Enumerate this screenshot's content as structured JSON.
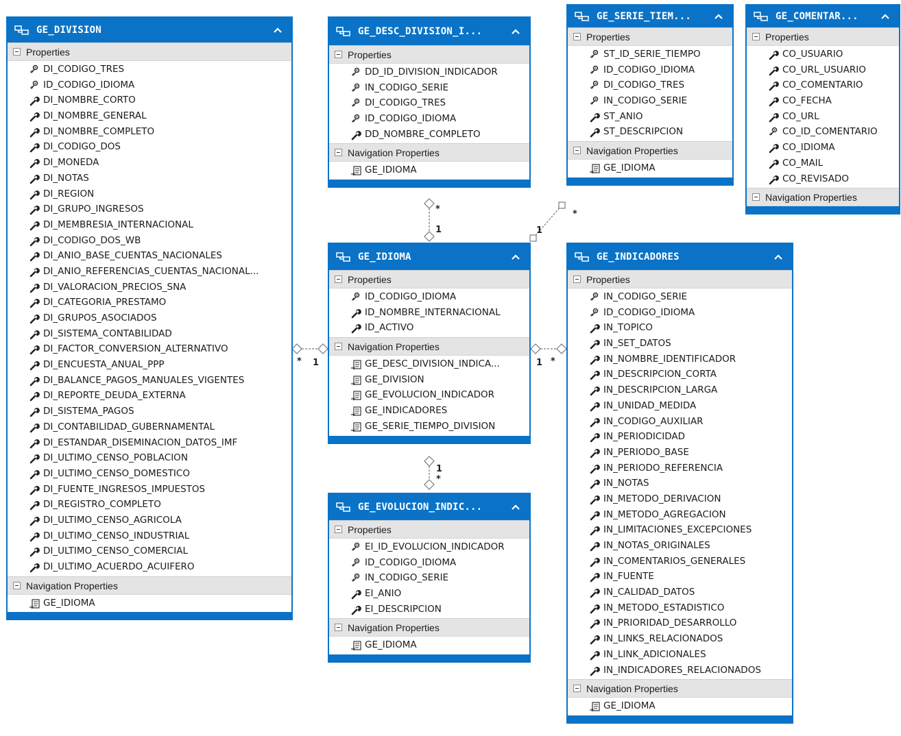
{
  "entities": {
    "division": {
      "title": "GE_DIVISION",
      "properties_label": "Properties",
      "nav_label": "Navigation Properties",
      "properties": [
        {
          "name": "DI_CODIGO_TRES",
          "icon": "key-icon"
        },
        {
          "name": "ID_CODIGO_IDIOMA",
          "icon": "key-icon"
        },
        {
          "name": "DI_NOMBRE_CORTO",
          "icon": "property-wrench-icon"
        },
        {
          "name": "DI_NOMBRE_GENERAL",
          "icon": "property-wrench-icon"
        },
        {
          "name": "DI_NOMBRE_COMPLETO",
          "icon": "property-wrench-icon"
        },
        {
          "name": "DI_CODIGO_DOS",
          "icon": "property-wrench-icon"
        },
        {
          "name": "DI_MONEDA",
          "icon": "property-wrench-icon"
        },
        {
          "name": "DI_NOTAS",
          "icon": "property-wrench-icon"
        },
        {
          "name": "DI_REGION",
          "icon": "property-wrench-icon"
        },
        {
          "name": "DI_GRUPO_INGRESOS",
          "icon": "property-wrench-icon"
        },
        {
          "name": "DI_MEMBRESIA_INTERNACIONAL",
          "icon": "property-wrench-icon"
        },
        {
          "name": "DI_CODIGO_DOS_WB",
          "icon": "property-wrench-icon"
        },
        {
          "name": "DI_ANIO_BASE_CUENTAS_NACIONALES",
          "icon": "property-wrench-icon"
        },
        {
          "name": "DI_ANIO_REFERENCIAS_CUENTAS_NACIONAL...",
          "icon": "property-wrench-icon"
        },
        {
          "name": "DI_VALORACION_PRECIOS_SNA",
          "icon": "property-wrench-icon"
        },
        {
          "name": "DI_CATEGORIA_PRESTAMO",
          "icon": "property-wrench-icon"
        },
        {
          "name": "DI_GRUPOS_ASOCIADOS",
          "icon": "property-wrench-icon"
        },
        {
          "name": "DI_SISTEMA_CONTABILIDAD",
          "icon": "property-wrench-icon"
        },
        {
          "name": "DI_FACTOR_CONVERSION_ALTERNATIVO",
          "icon": "property-wrench-icon"
        },
        {
          "name": "DI_ENCUESTA_ANUAL_PPP",
          "icon": "property-wrench-icon"
        },
        {
          "name": "DI_BALANCE_PAGOS_MANUALES_VIGENTES",
          "icon": "property-wrench-icon"
        },
        {
          "name": "DI_REPORTE_DEUDA_EXTERNA",
          "icon": "property-wrench-icon"
        },
        {
          "name": "DI_SISTEMA_PAGOS",
          "icon": "property-wrench-icon"
        },
        {
          "name": "DI_CONTABILIDAD_GUBERNAMENTAL",
          "icon": "property-wrench-icon"
        },
        {
          "name": "DI_ESTANDAR_DISEMINACION_DATOS_IMF",
          "icon": "property-wrench-icon"
        },
        {
          "name": "DI_ULTIMO_CENSO_POBLACION",
          "icon": "property-wrench-icon"
        },
        {
          "name": "DI_ULTIMO_CENSO_DOMESTICO",
          "icon": "property-wrench-icon"
        },
        {
          "name": "DI_FUENTE_INGRESOS_IMPUESTOS",
          "icon": "property-wrench-icon"
        },
        {
          "name": "DI_REGISTRO_COMPLETO",
          "icon": "property-wrench-icon"
        },
        {
          "name": "DI_ULTIMO_CENSO_AGRICOLA",
          "icon": "property-wrench-icon"
        },
        {
          "name": "DI_ULTIMO_CENSO_INDUSTRIAL",
          "icon": "property-wrench-icon"
        },
        {
          "name": "DI_ULTIMO_CENSO_COMERCIAL",
          "icon": "property-wrench-icon"
        },
        {
          "name": "DI_ULTIMO_ACUERDO_ACUIFERO",
          "icon": "property-wrench-icon"
        }
      ],
      "navigation": [
        {
          "name": "GE_IDIOMA",
          "icon": "navigation-property-icon"
        }
      ]
    },
    "desc_division": {
      "title": "GE_DESC_DIVISION_I...",
      "properties_label": "Properties",
      "nav_label": "Navigation Properties",
      "properties": [
        {
          "name": "DD_ID_DIVISION_INDICADOR",
          "icon": "key-icon"
        },
        {
          "name": "IN_CODIGO_SERIE",
          "icon": "key-icon"
        },
        {
          "name": "DI_CODIGO_TRES",
          "icon": "key-icon"
        },
        {
          "name": "ID_CODIGO_IDIOMA",
          "icon": "key-icon"
        },
        {
          "name": "DD_NOMBRE_COMPLETO",
          "icon": "property-wrench-icon"
        }
      ],
      "navigation": [
        {
          "name": "GE_IDIOMA",
          "icon": "navigation-property-icon"
        }
      ]
    },
    "serie_tiempo": {
      "title": "GE_SERIE_TIEM...",
      "properties_label": "Properties",
      "nav_label": "Navigation Properties",
      "properties": [
        {
          "name": "ST_ID_SERIE_TIEMPO",
          "icon": "key-icon"
        },
        {
          "name": "ID_CODIGO_IDIOMA",
          "icon": "key-icon"
        },
        {
          "name": "DI_CODIGO_TRES",
          "icon": "key-icon"
        },
        {
          "name": "IN_CODIGO_SERIE",
          "icon": "key-icon"
        },
        {
          "name": "ST_ANIO",
          "icon": "property-wrench-icon"
        },
        {
          "name": "ST_DESCRIPCION",
          "icon": "property-wrench-icon"
        }
      ],
      "navigation": [
        {
          "name": "GE_IDIOMA",
          "icon": "navigation-property-icon"
        }
      ]
    },
    "comentario": {
      "title": "GE_COMENTAR...",
      "properties_label": "Properties",
      "nav_label": "Navigation Properties",
      "properties": [
        {
          "name": "CO_USUARIO",
          "icon": "property-wrench-icon"
        },
        {
          "name": "CO_URL_USUARIO",
          "icon": "property-wrench-icon"
        },
        {
          "name": "CO_COMENTARIO",
          "icon": "property-wrench-icon"
        },
        {
          "name": "CO_FECHA",
          "icon": "property-wrench-icon"
        },
        {
          "name": "CO_URL",
          "icon": "property-wrench-icon"
        },
        {
          "name": "CO_ID_COMENTARIO",
          "icon": "key-icon"
        },
        {
          "name": "CO_IDIOMA",
          "icon": "property-wrench-icon"
        },
        {
          "name": "CO_MAIL",
          "icon": "property-wrench-icon"
        },
        {
          "name": "CO_REVISADO",
          "icon": "property-wrench-icon"
        }
      ],
      "navigation": []
    },
    "idioma": {
      "title": "GE_IDIOMA",
      "properties_label": "Properties",
      "nav_label": "Navigation Properties",
      "properties": [
        {
          "name": "ID_CODIGO_IDIOMA",
          "icon": "key-icon"
        },
        {
          "name": "ID_NOMBRE_INTERNACIONAL",
          "icon": "property-wrench-icon"
        },
        {
          "name": "ID_ACTIVO",
          "icon": "property-wrench-icon"
        }
      ],
      "navigation": [
        {
          "name": "GE_DESC_DIVISION_INDICA...",
          "icon": "navigation-property-icon"
        },
        {
          "name": "GE_DIVISION",
          "icon": "navigation-property-icon"
        },
        {
          "name": "GE_EVOLUCION_INDICADOR",
          "icon": "navigation-property-icon"
        },
        {
          "name": "GE_INDICADORES",
          "icon": "navigation-property-icon"
        },
        {
          "name": "GE_SERIE_TIEMPO_DIVISION",
          "icon": "navigation-property-icon"
        }
      ]
    },
    "evolucion": {
      "title": "GE_EVOLUCION_INDIC...",
      "properties_label": "Properties",
      "nav_label": "Navigation Properties",
      "properties": [
        {
          "name": "EI_ID_EVOLUCION_INDICADOR",
          "icon": "key-icon"
        },
        {
          "name": "ID_CODIGO_IDIOMA",
          "icon": "key-icon"
        },
        {
          "name": "IN_CODIGO_SERIE",
          "icon": "key-icon"
        },
        {
          "name": "EI_ANIO",
          "icon": "property-wrench-icon"
        },
        {
          "name": "EI_DESCRIPCION",
          "icon": "property-wrench-icon"
        }
      ],
      "navigation": [
        {
          "name": "GE_IDIOMA",
          "icon": "navigation-property-icon"
        }
      ]
    },
    "indicadores": {
      "title": "GE_INDICADORES",
      "properties_label": "Properties",
      "nav_label": "Navigation Properties",
      "properties": [
        {
          "name": "IN_CODIGO_SERIE",
          "icon": "key-icon"
        },
        {
          "name": "ID_CODIGO_IDIOMA",
          "icon": "key-icon"
        },
        {
          "name": "IN_TOPICO",
          "icon": "property-wrench-icon"
        },
        {
          "name": "IN_SET_DATOS",
          "icon": "property-wrench-icon"
        },
        {
          "name": "IN_NOMBRE_IDENTIFICADOR",
          "icon": "property-wrench-icon"
        },
        {
          "name": "IN_DESCRIPCION_CORTA",
          "icon": "property-wrench-icon"
        },
        {
          "name": "IN_DESCRIPCION_LARGA",
          "icon": "property-wrench-icon"
        },
        {
          "name": "IN_UNIDAD_MEDIDA",
          "icon": "property-wrench-icon"
        },
        {
          "name": "IN_CODIGO_AUXILIAR",
          "icon": "property-wrench-icon"
        },
        {
          "name": "IN_PERIODICIDAD",
          "icon": "property-wrench-icon"
        },
        {
          "name": "IN_PERIODO_BASE",
          "icon": "property-wrench-icon"
        },
        {
          "name": "IN_PERIODO_REFERENCIA",
          "icon": "property-wrench-icon"
        },
        {
          "name": "IN_NOTAS",
          "icon": "property-wrench-icon"
        },
        {
          "name": "IN_METODO_DERIVACION",
          "icon": "property-wrench-icon"
        },
        {
          "name": "IN_METODO_AGREGACION",
          "icon": "property-wrench-icon"
        },
        {
          "name": "IN_LIMITACIONES_EXCEPCIONES",
          "icon": "property-wrench-icon"
        },
        {
          "name": "IN_NOTAS_ORIGINALES",
          "icon": "property-wrench-icon"
        },
        {
          "name": "IN_COMENTARIOS_GENERALES",
          "icon": "property-wrench-icon"
        },
        {
          "name": "IN_FUENTE",
          "icon": "property-wrench-icon"
        },
        {
          "name": "IN_CALIDAD_DATOS",
          "icon": "property-wrench-icon"
        },
        {
          "name": "IN_METODO_ESTADISTICO",
          "icon": "property-wrench-icon"
        },
        {
          "name": "IN_PRIORIDAD_DESARROLLO",
          "icon": "property-wrench-icon"
        },
        {
          "name": "IN_LINKS_RELACIONADOS",
          "icon": "property-wrench-icon"
        },
        {
          "name": "IN_LINK_ADICIONALES",
          "icon": "property-wrench-icon"
        },
        {
          "name": "IN_INDICADORES_RELACIONADOS",
          "icon": "property-wrench-icon"
        }
      ],
      "navigation": [
        {
          "name": "GE_IDIOMA",
          "icon": "navigation-property-icon"
        }
      ]
    }
  },
  "associations": [
    {
      "from": "GE_DESC_DIVISION_I...",
      "to": "GE_IDIOMA",
      "from_multiplicity": "*",
      "to_multiplicity": "1"
    },
    {
      "from": "GE_SERIE_TIEM...",
      "to": "GE_IDIOMA",
      "from_multiplicity": "*",
      "to_multiplicity": "1"
    },
    {
      "from": "GE_DIVISION",
      "to": "GE_IDIOMA",
      "from_multiplicity": "*",
      "to_multiplicity": "1"
    },
    {
      "from": "GE_INDICADORES",
      "to": "GE_IDIOMA",
      "from_multiplicity": "*",
      "to_multiplicity": "1"
    },
    {
      "from": "GE_EVOLUCION_INDIC...",
      "to": "GE_IDIOMA",
      "from_multiplicity": "*",
      "to_multiplicity": "1"
    }
  ],
  "colors": {
    "header": "#0a73c7",
    "section_header": "#e4e4e4",
    "connector": "#7a7a7a"
  }
}
